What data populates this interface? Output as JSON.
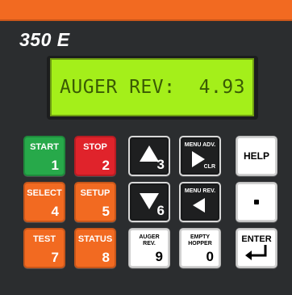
{
  "device": {
    "model": "350 E"
  },
  "display": {
    "label": "AUGER REV:",
    "value": "4.93"
  },
  "keys": {
    "start": {
      "label": "START",
      "num": "1"
    },
    "stop": {
      "label": "STOP",
      "num": "2"
    },
    "up": {
      "num": "3"
    },
    "menu_adv": {
      "label": "MENU ADV.",
      "sub": "CLR"
    },
    "help": {
      "label": "HELP"
    },
    "select": {
      "label": "SELECT",
      "num": "4"
    },
    "setup": {
      "label": "SETUP",
      "num": "5"
    },
    "down": {
      "num": "6"
    },
    "menu_rev": {
      "label": "MENU REV."
    },
    "test": {
      "label": "TEST",
      "num": "7"
    },
    "status": {
      "label": "STATUS",
      "num": "8"
    },
    "auger_rev": {
      "label_1": "AUGER",
      "label_2": "REV.",
      "num": "9"
    },
    "empty_hopper": {
      "label_1": "EMPTY",
      "label_2": "HOPPER",
      "num": "0"
    },
    "enter": {
      "label": "ENTER"
    }
  },
  "colors": {
    "panel": "#2b2d2f",
    "stripe": "#f26a21",
    "lcd": "#a4ef1a",
    "start": "#27a94a",
    "stop": "#e0232b",
    "orange_keys": "#f26a21"
  }
}
